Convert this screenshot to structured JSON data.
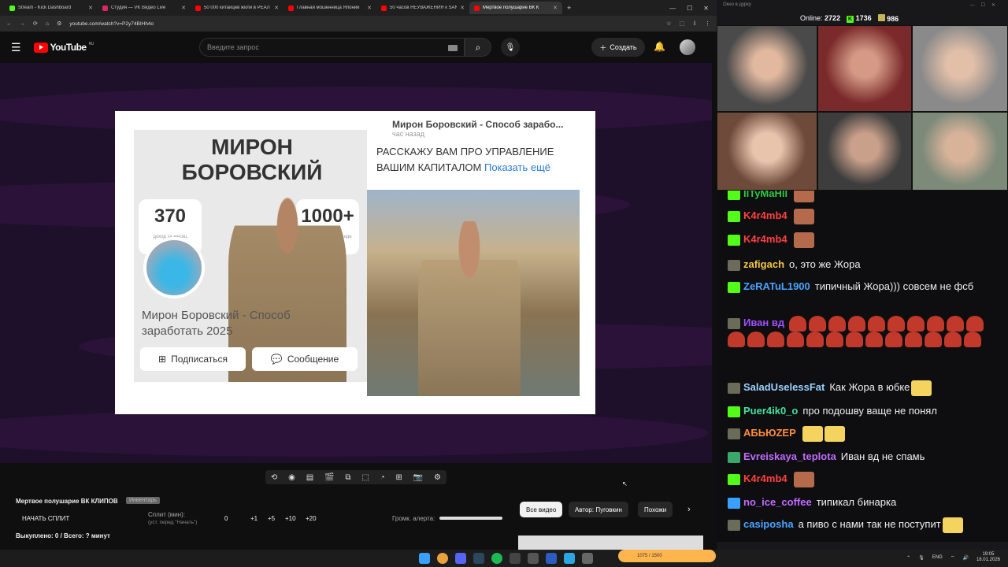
{
  "browser": {
    "tabs": [
      {
        "title": "Stream - Kick Dashboard",
        "fav": "#53fc18"
      },
      {
        "title": "Студия — VK Видео Live",
        "fav": "#e0246a"
      },
      {
        "title": "50 000 китайцев жили в РЕАЛ",
        "fav": "#f00"
      },
      {
        "title": "Главная мошенница Японии",
        "fav": "#f00"
      },
      {
        "title": "50 часов НЕУВАЖЕНИЯ к SAN",
        "fav": "#f00"
      },
      {
        "title": "Мертвое полушарие ВК К",
        "fav": "#f00"
      }
    ],
    "url": "youtube.com/watch?v=P2y74BIHh4o"
  },
  "youtube": {
    "logo": "YouTube",
    "region": "RU",
    "search_placeholder": "Введите запрос",
    "create": "Создать"
  },
  "video": {
    "profile_name": "МИРОН БОРОВСКИЙ",
    "stat1": "370",
    "stat1_label": "доход за месяц",
    "stat2": "1000+",
    "stat2_label": "участников в команде",
    "profile_title": "Мирон Боровский - Способ заработать 2025",
    "subscribe": "Подписаться",
    "message": "Сообщение",
    "post_header": "Мирон Боровский - Способ зарабо...",
    "post_time": "час назад",
    "post_text": "РАССКАЖУ ВАМ ПРО УПРАВЛЕНИЕ ВАШИМ КАПИТАЛОМ",
    "post_more": "Показать ещё"
  },
  "controls": {
    "title": "Мертвое полушарие ВК КЛИПОВ",
    "badge": "Инвентарь",
    "start_split": "НАЧАТЬ СПЛИТ",
    "split_label": "Сплит (мин):",
    "split_sub": "(уст. перед \"Начать\")",
    "split_value": "0",
    "increments": [
      "+1",
      "+5",
      "+10",
      "+20"
    ],
    "alert_volume": "Громк. алерта:",
    "alert_volume_level": 1.0,
    "bought": "Выкуплено: 0 / Всего: ? минут",
    "chips": [
      "Все видео",
      "Автор: Пуговкин",
      "Похожи"
    ]
  },
  "stream": {
    "window_title": "Окно в дурку",
    "online_label": "Online:",
    "online": "2722",
    "kick_viewers": "1736",
    "other_viewers": "986"
  },
  "chat": [
    {
      "user": "llTyMaHll",
      "color": "#2ecc40",
      "text": "",
      "badge": "bk",
      "emotes": [
        "em1"
      ]
    },
    {
      "user": "K4r4mb4",
      "color": "#ff4040",
      "text": "",
      "badge": "bk",
      "emotes": [
        "em1"
      ]
    },
    {
      "user": "K4r4mb4",
      "color": "#ff4040",
      "text": "",
      "badge": "bk",
      "emotes": [
        "em1"
      ]
    },
    {
      "user": "zafigach",
      "color": "#f4c542",
      "text": "о, это же Жора",
      "badge": "bs",
      "emotes": []
    },
    {
      "user": "ZeRATuL1900",
      "color": "#4aa3ff",
      "text": "типичный Жора))) совсем не фсб",
      "badge": "bk",
      "emotes": []
    },
    {
      "user": "Иван вд",
      "color": "#a050ff",
      "text": "",
      "badge": "bs",
      "emotes": [
        "spam"
      ]
    },
    {
      "user": "SaladUselessFat",
      "color": "#9ad0ff",
      "text": "Как Жора в юбке",
      "badge": "bs",
      "emotes": [
        "em2"
      ]
    },
    {
      "user": "Puer4ik0_o",
      "color": "#46e0a0",
      "text": "про подошву ваще не понял",
      "badge": "bk",
      "emotes": []
    },
    {
      "user": "АБЬЮZEP",
      "color": "#ff8c3a",
      "text": "",
      "badge": "bs",
      "emotes": [
        "em2",
        "em2"
      ]
    },
    {
      "user": "Evreiskaya_teplota",
      "color": "#c06bff",
      "text": "Иван вд не спамь",
      "badge": "bv",
      "emotes": []
    },
    {
      "user": "K4r4mb4",
      "color": "#ff4040",
      "text": "",
      "badge": "bk",
      "emotes": [
        "em1"
      ]
    },
    {
      "user": "no_ice_coffee",
      "color": "#c06bff",
      "text": "типикал бинарка",
      "badge": "bb",
      "emotes": []
    },
    {
      "user": "casiposha",
      "color": "#4aa3ff",
      "text": "а пиво с нами так не поступит",
      "badge": "bs",
      "emotes": [
        "em2"
      ]
    }
  ],
  "taskbar": {
    "lang": "ENG",
    "time": "19:05",
    "date": "18.01.2026",
    "music": "1075 / 1500"
  }
}
